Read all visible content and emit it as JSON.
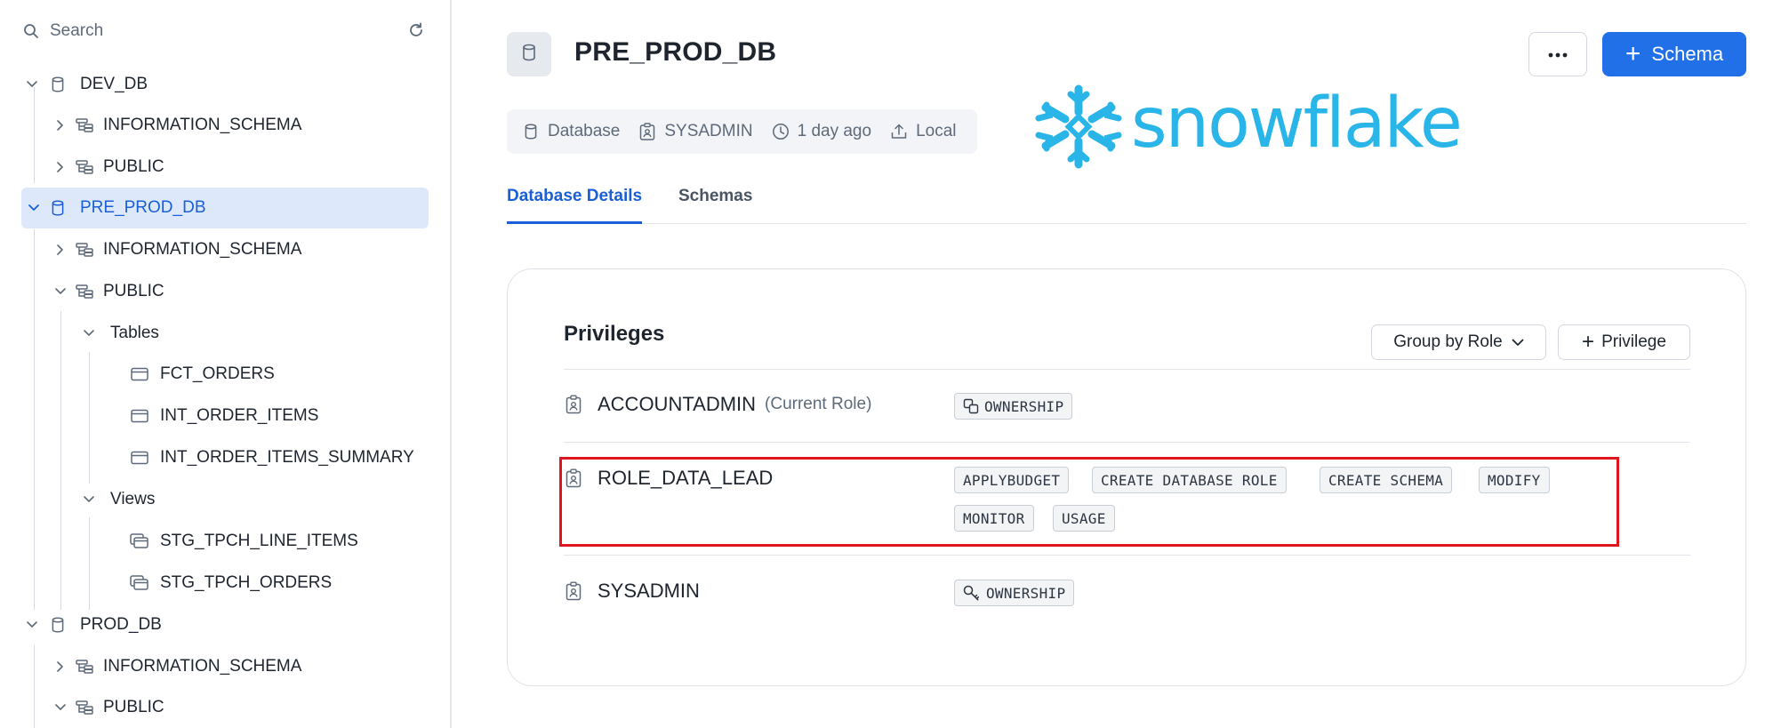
{
  "sidebar": {
    "search_placeholder": "Search",
    "tree": [
      {
        "label": "DEV_DB",
        "type": "database"
      },
      {
        "label": "INFORMATION_SCHEMA",
        "type": "schema"
      },
      {
        "label": "PUBLIC",
        "type": "schema"
      },
      {
        "label": "PRE_PROD_DB",
        "type": "database",
        "selected": true
      },
      {
        "label": "INFORMATION_SCHEMA",
        "type": "schema"
      },
      {
        "label": "PUBLIC",
        "type": "schema"
      },
      {
        "label": "Tables",
        "type": "folder"
      },
      {
        "label": "FCT_ORDERS",
        "type": "table"
      },
      {
        "label": "INT_ORDER_ITEMS",
        "type": "table"
      },
      {
        "label": "INT_ORDER_ITEMS_SUMMARY",
        "type": "table"
      },
      {
        "label": "Views",
        "type": "folder"
      },
      {
        "label": "STG_TPCH_LINE_ITEMS",
        "type": "view"
      },
      {
        "label": "STG_TPCH_ORDERS",
        "type": "view"
      },
      {
        "label": "PROD_DB",
        "type": "database"
      },
      {
        "label": "INFORMATION_SCHEMA",
        "type": "schema"
      },
      {
        "label": "PUBLIC",
        "type": "schema"
      }
    ]
  },
  "header": {
    "title": "PRE_PROD_DB",
    "more_icon": "ellipsis-icon",
    "add_schema_label": "Schema"
  },
  "meta": {
    "type": "Database",
    "owner": "SYSADMIN",
    "updated": "1 day ago",
    "source": "Local"
  },
  "logo": {
    "text": "snowflake",
    "color": "#29b5e8"
  },
  "tabs": [
    {
      "label": "Database Details",
      "active": true
    },
    {
      "label": "Schemas",
      "active": false
    }
  ],
  "privileges": {
    "title": "Privileges",
    "group_by_label": "Group by Role",
    "add_privilege_label": "Privilege",
    "roles": [
      {
        "name": "ACCOUNTADMIN",
        "note": "(Current Role)",
        "privileges": [
          "OWNERSHIP"
        ]
      },
      {
        "name": "ROLE_DATA_LEAD",
        "note": "",
        "privileges": [
          "APPLYBUDGET",
          "CREATE DATABASE ROLE",
          "CREATE SCHEMA",
          "MODIFY",
          "MONITOR",
          "USAGE"
        ],
        "highlighted": true
      },
      {
        "name": "SYSADMIN",
        "note": "",
        "privileges": [
          "OWNERSHIP"
        ]
      }
    ]
  },
  "colors": {
    "accent": "#2170e8",
    "selected_bg": "#dde9fb",
    "highlight_border": "#e0161e"
  }
}
